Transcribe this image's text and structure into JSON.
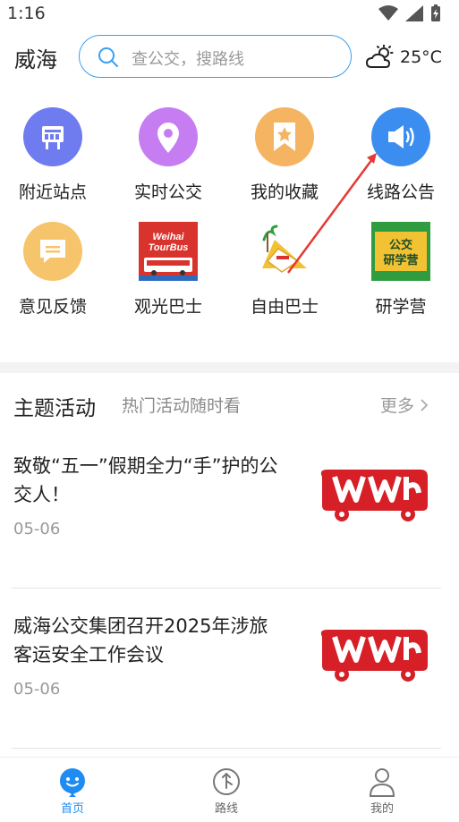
{
  "status": {
    "time": "1:16"
  },
  "header": {
    "city": "威海",
    "search_placeholder": "查公交，搜路线",
    "temperature": "25°C",
    "weather_icon": "partly-cloudy-icon"
  },
  "grid": [
    {
      "label": "附近站点",
      "icon": "bus-stop-icon",
      "color": "#6f7cf0"
    },
    {
      "label": "实时公交",
      "icon": "location-pin-icon",
      "color": "#c77df2"
    },
    {
      "label": "我的收藏",
      "icon": "bookmark-star-icon",
      "color": "#f5b461"
    },
    {
      "label": "线路公告",
      "icon": "megaphone-icon",
      "color": "#3b8ef0"
    },
    {
      "label": "意见反馈",
      "icon": "chat-bubble-icon",
      "color": "#f5c46b"
    },
    {
      "label": "观光巴士",
      "icon": "tour-bus-icon",
      "color": "#d8332c",
      "image_text": "Weihai TourBus"
    },
    {
      "label": "自由巴士",
      "icon": "free-bus-icon",
      "color": "#f3c233"
    },
    {
      "label": "研学营",
      "icon": "study-camp-icon",
      "color": "#2f9c3f",
      "image_text": "公交研学营"
    }
  ],
  "section": {
    "title": "主题活动",
    "subtitle": "热门活动随时看",
    "more": "更多"
  },
  "news": [
    {
      "title": "致敬“五一”假期全力“手”护的公交人！",
      "date": "05-06"
    },
    {
      "title": "威海公交集团召开2025年涉旅客运安全工作会议",
      "date": "05-06"
    }
  ],
  "bottom_nav": [
    {
      "label": "首页",
      "active": true
    },
    {
      "label": "路线",
      "active": false
    },
    {
      "label": "我的",
      "active": false
    }
  ],
  "colors": {
    "accent": "#1e8cf0",
    "annotation_arrow": "#e53935",
    "brand_red": "#d61f26"
  }
}
